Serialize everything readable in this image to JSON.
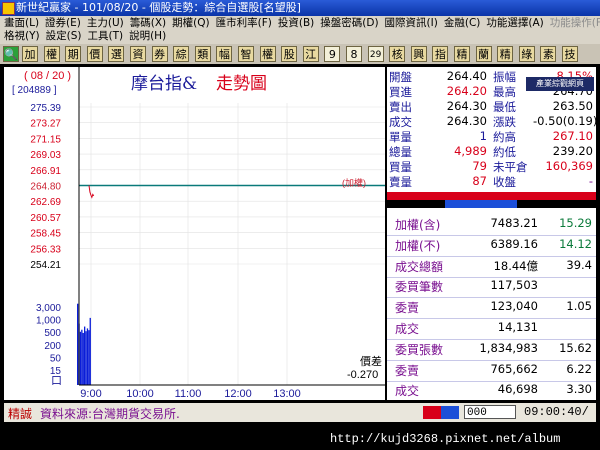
{
  "window": {
    "title": "新世紀贏家 - 101/08/20 - 個股走勢：綜合自選股[名望股]"
  },
  "menu": {
    "row1": [
      "畫面(L)",
      "證券(E)",
      "主力(U)",
      "籌碼(X)",
      "期權(Q)",
      "匯市利率(F)",
      "投資(B)",
      "操盤密碼(D)",
      "國際資訊(I)",
      "金融(C)",
      "功能選擇(A)"
    ],
    "row1_disabled": [
      "功能操作(F)"
    ],
    "row2": [
      "格視(Y)",
      "設定(S)",
      "工具(T)",
      "說明(H)"
    ]
  },
  "toolbar": {
    "items": [
      "加",
      "權",
      "期",
      "價",
      "選",
      "資",
      "券",
      "綜",
      "類",
      "幅",
      "智",
      "權",
      "股",
      "江",
      "9",
      "8",
      "29",
      "核",
      "興",
      "指",
      "精",
      "蘭",
      "精",
      "綠",
      "素",
      "技"
    ]
  },
  "chart": {
    "date_badge": "( 08 / 20 )",
    "volume_badge": "[ 204889 ]",
    "title_part1": "摩台指&",
    "title_part2": "走勢圖",
    "ref_label": "(加權)",
    "diff_label": "價差",
    "diff_value": "-0.270",
    "vol_unit": "口",
    "price_ticks": [
      "275.39",
      "273.27",
      "271.15",
      "269.03",
      "266.91",
      "264.80",
      "262.69",
      "260.57",
      "258.45",
      "256.33",
      "254.21"
    ],
    "volume_ticks": [
      "3,000",
      "1,000",
      "500",
      "200",
      "50",
      "15"
    ],
    "time_ticks": [
      "9:00",
      "10:00",
      "11:00",
      "12:00",
      "13:00"
    ]
  },
  "chart_data": {
    "type": "line",
    "title": "摩台指& 走勢圖",
    "xlabel": "",
    "ylabel": "",
    "ylim": [
      254.21,
      275.39
    ],
    "grid": true,
    "reference_price": 264.8,
    "x": [
      "9:00",
      "9:01",
      "9:02",
      "9:03",
      "9:04",
      "9:05"
    ],
    "series": [
      {
        "values": [
          264.8,
          263.9,
          263.5,
          263.2,
          263.6,
          263.4
        ]
      }
    ],
    "volume_bars": [
      2800,
      400,
      180,
      220,
      160,
      300,
      190,
      250,
      210,
      700
    ]
  },
  "quote": {
    "popup": "產業綜觀網頁",
    "rows": [
      {
        "l1": "開盤",
        "v1": "264.40",
        "l2": "振幅",
        "v2": "8.15%"
      },
      {
        "l1": "買進",
        "v1": "264.20",
        "l2": "最高",
        "v2": "264.70"
      },
      {
        "l1": "賣出",
        "v1": "264.30",
        "l2": "最低",
        "v2": "263.50"
      },
      {
        "l1": "成交",
        "v1": "264.30",
        "l2": "漲跌",
        "v2": "-0.50(0.19)"
      },
      {
        "l1": "單量",
        "v1": "1",
        "l2": "約高",
        "v2": "267.10"
      },
      {
        "l1": "總量",
        "v1": "4,989",
        "l2": "約低",
        "v2": "239.20"
      },
      {
        "l1": "買量",
        "v1": "79",
        "l2": "未平倉",
        "v2": "160,369"
      },
      {
        "l1": "賣量",
        "v1": "87",
        "l2": "收盤",
        "v2": "-"
      }
    ]
  },
  "stats": [
    {
      "label": "加權(含)",
      "value": "7483.21",
      "pct": "15.29"
    },
    {
      "label": "加權(不)",
      "value": "6389.16",
      "pct": "14.12"
    },
    {
      "label": "成交總額",
      "value": "18.44億",
      "pct": "39.4"
    },
    {
      "label": "委買筆數",
      "value": "117,503",
      "pct": ""
    },
    {
      "label": "委賣",
      "value": "123,040",
      "pct": "1.05"
    },
    {
      "label": "成交",
      "value": "14,131",
      "pct": ""
    },
    {
      "label": "委買張數",
      "value": "1,834,983",
      "pct": "15.62"
    },
    {
      "label": "委賣",
      "value": "765,662",
      "pct": "6.22"
    },
    {
      "label": "成交",
      "value": "46,698",
      "pct": "3.30"
    }
  ],
  "status": {
    "tag": "精誠",
    "source": "資料來源:台灣期貨交易所.",
    "input": "000",
    "time": "09:00:40/"
  },
  "footer": {
    "url": "http://kujd3268.pixnet.net/album"
  },
  "colors": {
    "price_red": "#d8001a",
    "price_blue": "#1b1b9a",
    "ref_line": "#0a7a7a",
    "volume": "#0a1ed8"
  }
}
